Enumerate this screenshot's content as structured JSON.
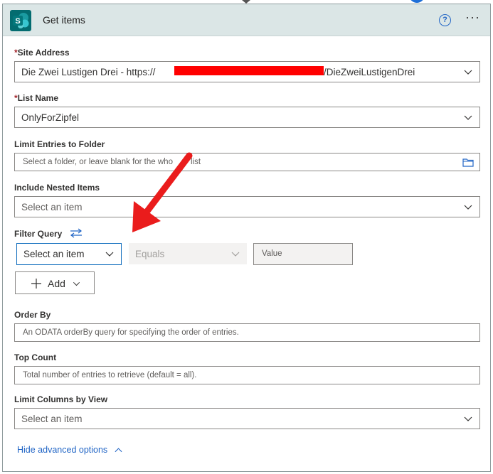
{
  "header": {
    "title": "Get items",
    "help_glyph": "?",
    "more_glyph": "···",
    "logo_letter": "S"
  },
  "fields": {
    "site_address": {
      "label": "Site Address",
      "required": true,
      "value_prefix": "Die Zwei Lustigen Drei - https://",
      "value_suffix": "/DieZweiLustigenDrei"
    },
    "list_name": {
      "label": "List Name",
      "required": true,
      "value": "OnlyForZipfel"
    },
    "limit_folder": {
      "label": "Limit Entries to Folder",
      "placeholder_a": "Select a folder, or leave blank for the who",
      "placeholder_b": "list"
    },
    "nested": {
      "label": "Include Nested Items",
      "value": "Select an item"
    },
    "filter_query": {
      "label": "Filter Query",
      "select": "Select an item",
      "operator": "Equals",
      "value_placeholder": "Value",
      "add_label": "Add"
    },
    "order_by": {
      "label": "Order By",
      "placeholder": "An ODATA orderBy query for specifying the order of entries."
    },
    "top_count": {
      "label": "Top Count",
      "placeholder": "Total number of entries to retrieve (default = all)."
    },
    "limit_columns": {
      "label": "Limit Columns by View",
      "value": "Select an item"
    }
  },
  "footer": {
    "hide_advanced": "Hide advanced options"
  },
  "colors": {
    "header_bg": "#dbe6e6",
    "accent": "#2266c6",
    "logo": "#036c70",
    "required": "#a4262c",
    "arrow": "#ea1c1c"
  }
}
